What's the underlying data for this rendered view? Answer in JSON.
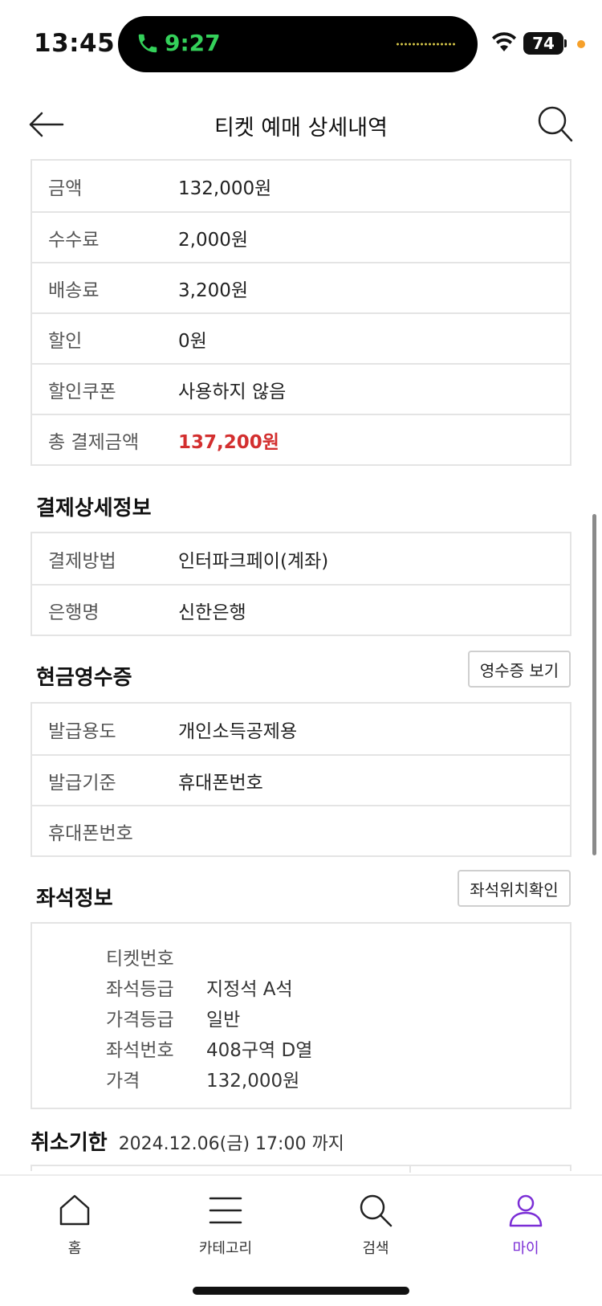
{
  "status": {
    "time": "13:45",
    "call_time": "9:27",
    "battery": "74"
  },
  "header": {
    "title": "티켓 예매 상세내역"
  },
  "payment": {
    "rows": [
      {
        "label": "금액",
        "value": "132,000원"
      },
      {
        "label": "수수료",
        "value": "2,000원"
      },
      {
        "label": "배송료",
        "value": "3,200원"
      },
      {
        "label": "할인",
        "value": "0원"
      },
      {
        "label": "할인쿠폰",
        "value": "사용하지 않음"
      },
      {
        "label": "총 결제금액",
        "value": "137,200원"
      }
    ],
    "total_color": "#d32f2f"
  },
  "payment_detail": {
    "title": "결제상세정보",
    "rows": [
      {
        "label": "결제방법",
        "value": "인터파크페이(계좌)"
      },
      {
        "label": "은행명",
        "value": "신한은행"
      }
    ]
  },
  "cash_receipt": {
    "title": "현금영수증",
    "button": "영수증 보기",
    "rows": [
      {
        "label": "발급용도",
        "value": "개인소득공제용"
      },
      {
        "label": "발급기준",
        "value": "휴대폰번호"
      },
      {
        "label": "휴대폰번호",
        "value": ""
      }
    ]
  },
  "seat_info": {
    "title": "좌석정보",
    "button": "좌석위치확인",
    "rows": [
      {
        "label": "티켓번호",
        "value": ""
      },
      {
        "label": "좌석등급",
        "value": "지정석 A석"
      },
      {
        "label": "가격등급",
        "value": "일반"
      },
      {
        "label": "좌석번호",
        "value": "408구역 D열"
      },
      {
        "label": "가격",
        "value": "132,000원"
      }
    ]
  },
  "cancel": {
    "title": "취소기한",
    "date": "2024.12.06(금) 17:00 까지"
  },
  "nav": {
    "items": [
      {
        "label": "홈",
        "icon": "home-icon"
      },
      {
        "label": "카테고리",
        "icon": "menu-icon"
      },
      {
        "label": "검색",
        "icon": "search-icon"
      },
      {
        "label": "마이",
        "icon": "user-icon"
      }
    ],
    "active_color": "#7b2ed6"
  }
}
